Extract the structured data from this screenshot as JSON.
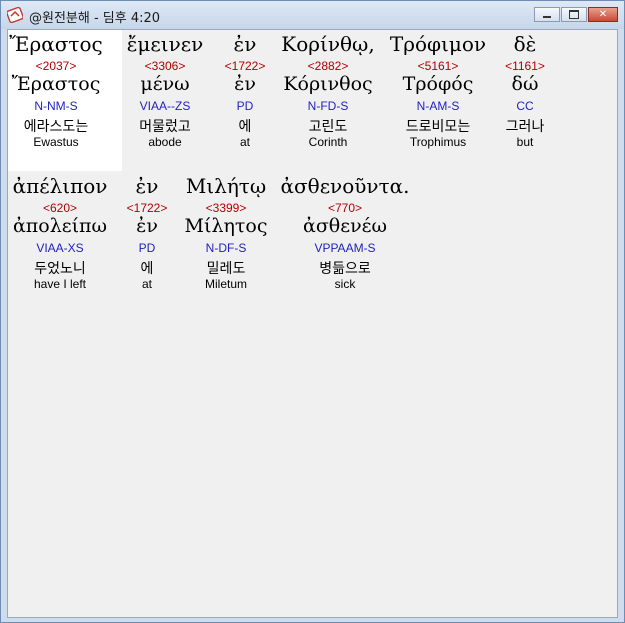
{
  "window": {
    "title": "@원전분해 - 딤후 4:20",
    "minimize_symbol": "",
    "maximize_symbol": "",
    "close_symbol": "✕"
  },
  "rows": [
    {
      "words": [
        {
          "greek": "Ἔραστος",
          "strong": "<2037>",
          "lemma": "Ἔραστος",
          "morph": "N-NM-S",
          "korean": "에라스도는",
          "english": "Ewastus"
        },
        {
          "greek": "ἔμεινεν",
          "strong": "<3306>",
          "lemma": "μένω",
          "morph": "VIAA--ZS",
          "korean": "머물렀고",
          "english": "abode"
        },
        {
          "greek": "ἐν",
          "strong": "<1722>",
          "lemma": "ἐν",
          "morph": "PD",
          "korean": "에",
          "english": "at"
        },
        {
          "greek": "Κορίνθῳ,",
          "strong": "<2882>",
          "lemma": "Κόρινθος",
          "morph": "N-FD-S",
          "korean": "고린도",
          "english": "Corinth"
        },
        {
          "greek": "Τρόφιμον",
          "strong": "<5161>",
          "lemma": "Τρόφός",
          "morph": "N-AM-S",
          "korean": "드로비모는",
          "english": "Trophimus"
        },
        {
          "greek": "δὲ",
          "strong": "<1161>",
          "lemma": "δώ",
          "morph": "CC",
          "korean": "그러나",
          "english": "but"
        }
      ]
    },
    {
      "words": [
        {
          "greek": "ἀπέλιπον",
          "strong": "<620>",
          "lemma": "ἀπολείπω",
          "morph": "VIAA-XS",
          "korean": "두었노니",
          "english": "have I left"
        },
        {
          "greek": "ἐν",
          "strong": "<1722>",
          "lemma": "ἐν",
          "morph": "PD",
          "korean": "에",
          "english": "at"
        },
        {
          "greek": "Μιλήτῳ",
          "strong": "<3399>",
          "lemma": "Μίλητος",
          "morph": "N-DF-S",
          "korean": "밀레도",
          "english": "Miletum"
        },
        {
          "greek": "ἀσθενοῦντα.",
          "strong": "<770>",
          "lemma": "ἀσθενέω",
          "morph": "VPPAAM-S",
          "korean": "병듦으로",
          "english": "sick"
        }
      ]
    }
  ]
}
